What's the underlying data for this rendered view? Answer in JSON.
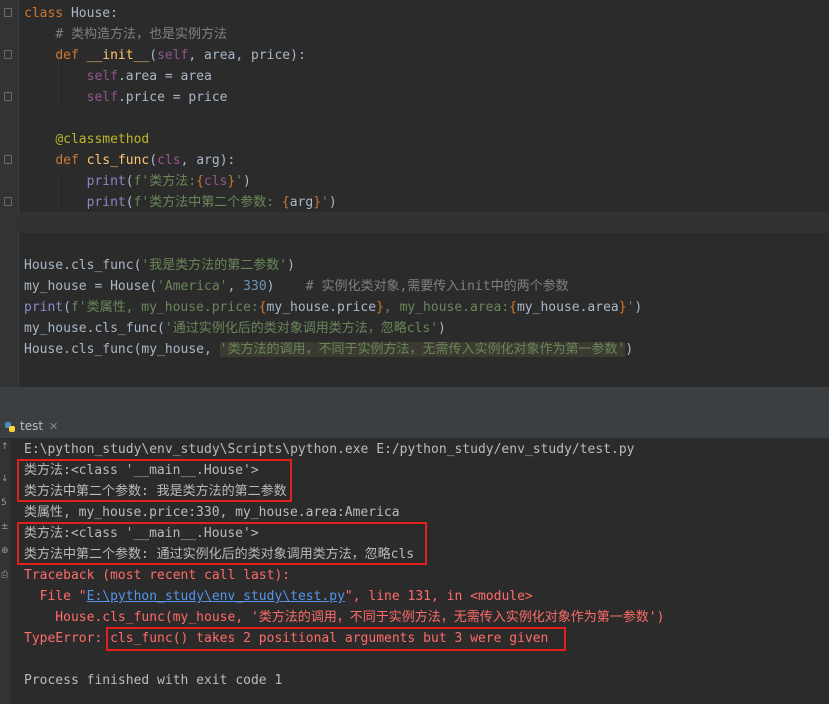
{
  "code": {
    "l1_kw": "class",
    "l1_name": " House",
    "l1_p": ":",
    "l2_comment": "# 类构造方法，也是实例方法",
    "l3_def": "def",
    "l3_fn": " __init__",
    "l3_p1": "(",
    "l3_self": "self",
    "l3_p2": ", area, price):",
    "l4_self": "self",
    "l4_rest": ".area = area",
    "l5_self": "self",
    "l5_rest": ".price = price",
    "l7_dec": "@classmethod",
    "l8_def": "def",
    "l8_fn": " cls_func",
    "l8_p1": "(",
    "l8_cls": "cls",
    "l8_p2": ", arg):",
    "l9_print": "print",
    "l9_p": "(",
    "l9_s1": "f'类方法:",
    "l9_b1": "{",
    "l9_v": "cls",
    "l9_b2": "}",
    "l9_s2": "'",
    "l9_end": ")",
    "l10_print": "print",
    "l10_p": "(",
    "l10_s1": "f'类方法中第二个参数: ",
    "l10_b1": "{",
    "l10_v": "arg",
    "l10_b2": "}",
    "l10_s2": "'",
    "l10_end": ")",
    "l13_a": "House.cls_func(",
    "l13_s": "'我是类方法的第二参数'",
    "l13_b": ")",
    "l14_a": "my_house = House(",
    "l14_s": "'America'",
    "l14_c": ", ",
    "l14_n": "330",
    "l14_b": ")",
    "l14_cm": "    # 实例化类对象,需要传入init中的两个参数",
    "l15_print": "print",
    "l15_p": "(",
    "l15_s1": "f'类属性, my_house.price:",
    "l15_b1": "{",
    "l15_v1": "my_house.price",
    "l15_b2": "}",
    "l15_s2": ", my_house.area:",
    "l15_b3": "{",
    "l15_v2": "my_house.area",
    "l15_b4": "}",
    "l15_s3": "'",
    "l15_end": ")",
    "l16_a": "my_house.cls_func(",
    "l16_s": "'通过实例化后的类对象调用类方法，忽略cls'",
    "l16_b": ")",
    "l17_a": "House.cls_func(my_house, ",
    "l17_s": "'类方法的调用，不同于实例方法，无需传入实例化对象作为第一参数'",
    "l17_b": ")"
  },
  "run_tab": {
    "label": "test",
    "close": "✕"
  },
  "console": {
    "cmd": "E:\\python_study\\env_study\\Scripts\\python.exe E:/python_study/env_study/test.py",
    "o1": "类方法:<class '__main__.House'>",
    "o2": "类方法中第二个参数: 我是类方法的第二参数",
    "o3": "类属性, my_house.price:330, my_house.area:America",
    "o4": "类方法:<class '__main__.House'>",
    "o5": "类方法中第二个参数: 通过实例化后的类对象调用类方法，忽略cls",
    "tb": "Traceback (most recent call last):",
    "file_a": "  File \"",
    "file_link": "E:\\python_study\\env_study\\test.py",
    "file_b": "\", line 131, in <module>",
    "src": "    House.cls_func(my_house, '类方法的调用，不同于实例方法，无需传入实例化对象作为第一参数')",
    "te": "TypeError: ",
    "msg": "cls_func() takes 2 positional arguments but 3 were given",
    "exit": "Process finished with exit code 1"
  },
  "gutter_tools": [
    "↑",
    "↓",
    "5",
    "±",
    "⊕",
    "⎙"
  ]
}
